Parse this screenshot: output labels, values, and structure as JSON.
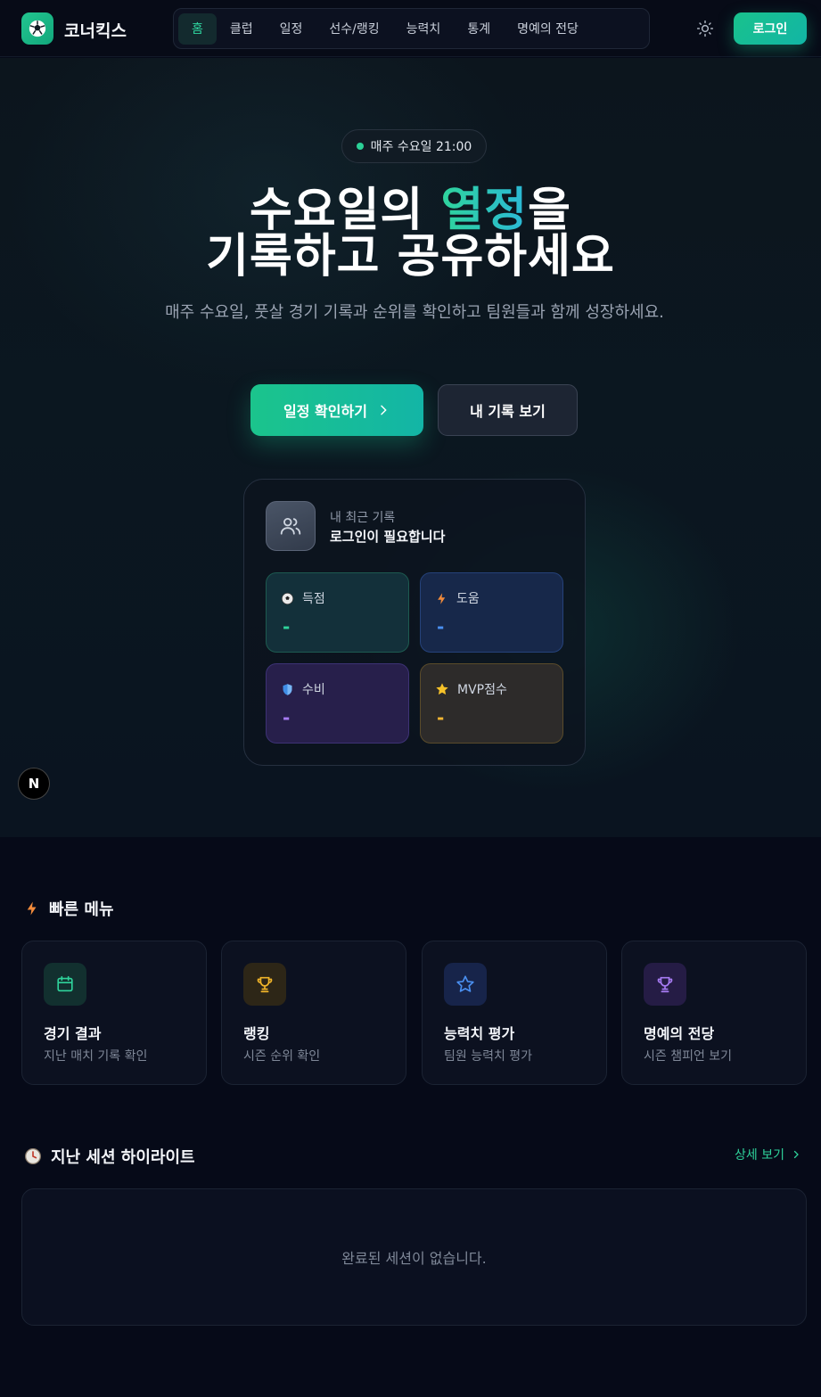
{
  "header": {
    "brand": "코너킥스",
    "nav": [
      "홈",
      "클럽",
      "일정",
      "선수/랭킹",
      "능력치",
      "통계",
      "명예의 전당"
    ],
    "active_nav": "홈",
    "login_label": "로그인"
  },
  "hero": {
    "pill_text": "매주 수요일 21:00",
    "title_line1_before": "수요일의 ",
    "title_line1_accent": "열정",
    "title_line1_after": "을",
    "title_line2": "기록하고 공유하세요",
    "subtitle": "매주 수요일, 풋살 경기 기록과 순위를 확인하고 팀원들과 함께 성장하세요.",
    "primary_button": "일정 확인하기",
    "secondary_button": "내 기록 보기"
  },
  "record_card": {
    "label": "내 최근 기록",
    "status": "로그인이 필요합니다",
    "stats": [
      {
        "label": "득점",
        "value": "-",
        "color": "#2fd39b",
        "icon": "soccer-ball-icon"
      },
      {
        "label": "도움",
        "value": "-",
        "color": "#4a8ff0",
        "icon": "lightning-icon"
      },
      {
        "label": "수비",
        "value": "-",
        "color": "#a77bf3",
        "icon": "shield-icon"
      },
      {
        "label": "MVP점수",
        "value": "-",
        "color": "#f3b632",
        "icon": "star-icon"
      }
    ]
  },
  "n_badge": "N",
  "quick_menu": {
    "title": "빠른 메뉴",
    "items": [
      {
        "title": "경기 결과",
        "desc": "지난 매치 기록 확인",
        "icon": "calendar-icon"
      },
      {
        "title": "랭킹",
        "desc": "시즌 순위 확인",
        "icon": "trophy-icon"
      },
      {
        "title": "능력치 평가",
        "desc": "팀원 능력치 평가",
        "icon": "star-icon"
      },
      {
        "title": "명예의 전당",
        "desc": "시즌 챔피언 보기",
        "icon": "trophy-icon"
      }
    ]
  },
  "highlights": {
    "title": "지난 세션 하이라이트",
    "more_label": "상세 보기",
    "empty_text": "완료된 세션이 없습니다."
  },
  "colors": {
    "accent": "#1bc48c",
    "background": "#060a18"
  }
}
